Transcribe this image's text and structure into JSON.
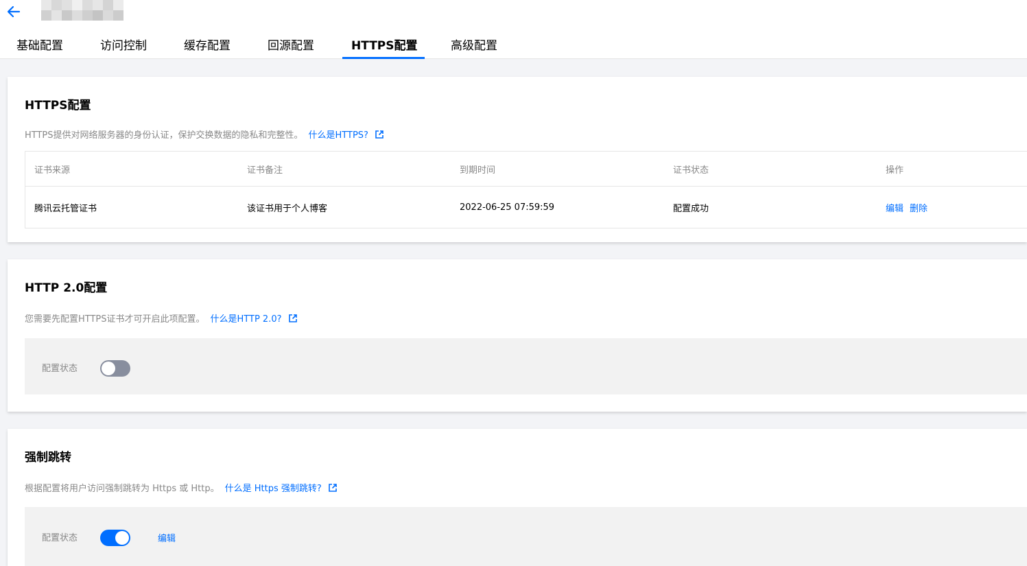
{
  "header": {
    "tabs": [
      {
        "label": "基础配置"
      },
      {
        "label": "访问控制"
      },
      {
        "label": "缓存配置"
      },
      {
        "label": "回源配置"
      },
      {
        "label": "HTTPS配置",
        "active": true
      },
      {
        "label": "高级配置"
      }
    ]
  },
  "https": {
    "title": "HTTPS配置",
    "desc": "HTTPS提供对网络服务器的身份认证，保护交换数据的隐私和完整性。",
    "link": "什么是HTTPS?",
    "table": {
      "headers": [
        "证书来源",
        "证书备注",
        "到期时间",
        "证书状态",
        "操作"
      ],
      "rows": [
        {
          "source": "腾讯云托管证书",
          "note": "该证书用于个人博客",
          "expires": "2022-06-25 07:59:59",
          "status": "配置成功",
          "edit": "编辑",
          "delete": "删除"
        }
      ]
    }
  },
  "http2": {
    "title": "HTTP 2.0配置",
    "desc": "您需要先配置HTTPS证书才可开启此项配置。",
    "link": "什么是HTTP 2.0?",
    "status_label": "配置状态",
    "enabled": false
  },
  "redirect": {
    "title": "强制跳转",
    "desc": "根据配置将用户访问强制跳转为 Https 或 Http。",
    "link": "什么是 Https 强制跳转?",
    "status_label": "配置状态",
    "enabled": true,
    "edit": "编辑"
  },
  "colors": {
    "accent": "#006eff",
    "switch_off": "#888e9e"
  },
  "icons": {
    "back": "arrow-left-icon",
    "external": "external-link-icon"
  }
}
